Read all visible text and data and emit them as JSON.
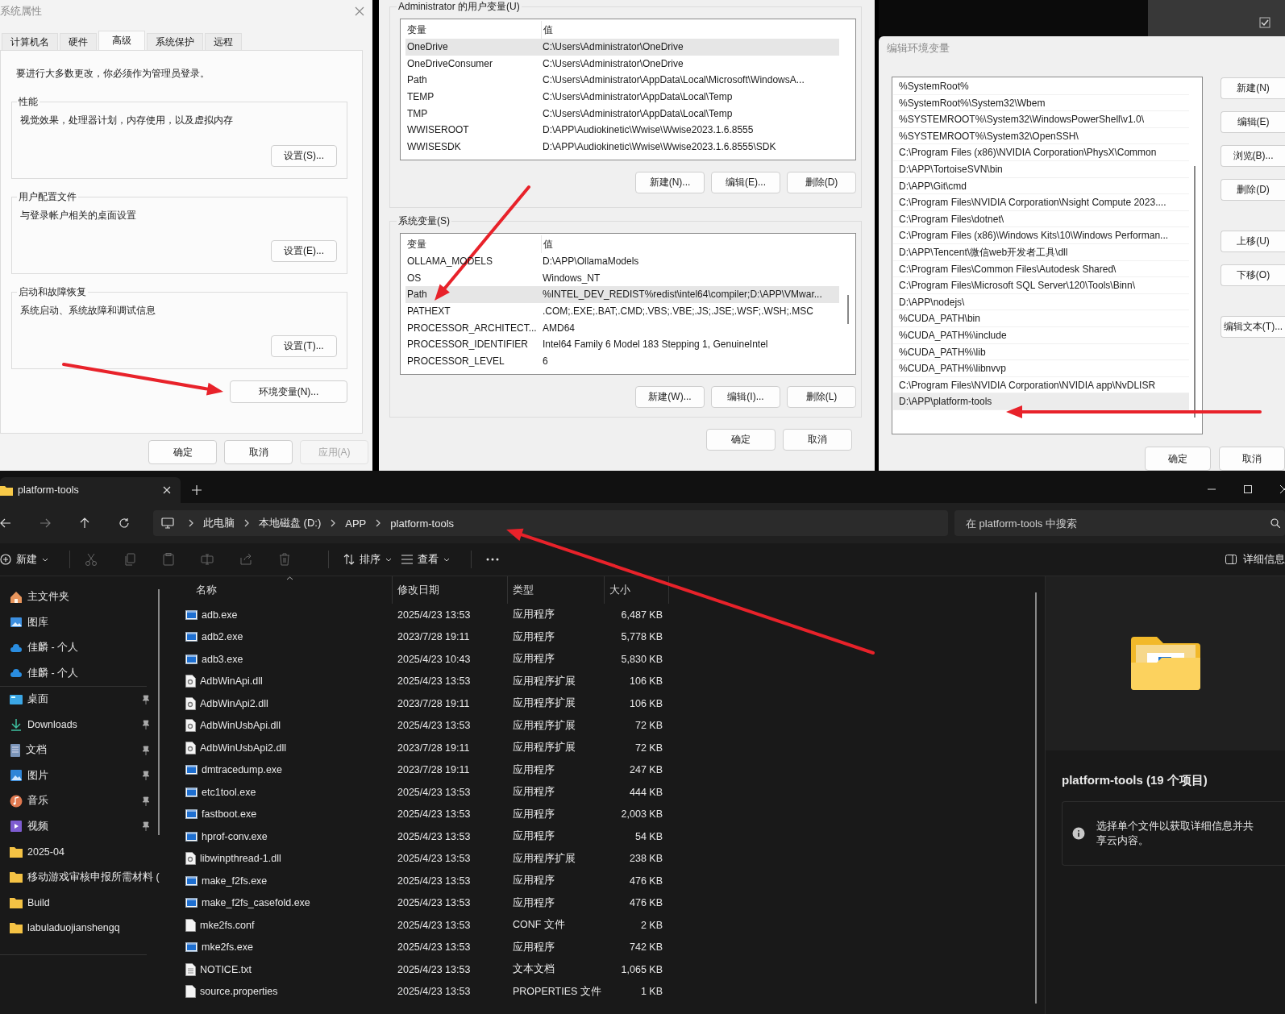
{
  "system_properties": {
    "title": "系统属性",
    "tabs": [
      {
        "label": "计算机名",
        "selected": false
      },
      {
        "label": "硬件",
        "selected": false
      },
      {
        "label": "高级",
        "selected": true
      },
      {
        "label": "系统保护",
        "selected": false
      },
      {
        "label": "远程",
        "selected": false
      }
    ],
    "notice": "要进行大多数更改，你必须作为管理员登录。",
    "groups": [
      {
        "title": "性能",
        "description": "视觉效果，处理器计划，内存使用，以及虚拟内存",
        "button": "设置(S)..."
      },
      {
        "title": "用户配置文件",
        "description": "与登录帐户相关的桌面设置",
        "button": "设置(E)..."
      },
      {
        "title": "启动和故障恢复",
        "description": "系统启动、系统故障和调试信息",
        "button": "设置(T)..."
      }
    ],
    "env_button": "环境变量(N)...",
    "buttons": [
      {
        "label": "确定",
        "disabled": false
      },
      {
        "label": "取消",
        "disabled": false
      },
      {
        "label": "应用(A)",
        "disabled": true
      }
    ]
  },
  "environment_variables": {
    "groups": [
      {
        "title": "Administrator 的用户变量(U)",
        "columns": [
          "变量",
          "值"
        ],
        "rows": [
          {
            "name": "OneDrive",
            "value": "C:\\Users\\Administrator\\OneDrive",
            "selected": true
          },
          {
            "name": "OneDriveConsumer",
            "value": "C:\\Users\\Administrator\\OneDrive",
            "selected": false
          },
          {
            "name": "Path",
            "value": "C:\\Users\\Administrator\\AppData\\Local\\Microsoft\\WindowsA...",
            "selected": false
          },
          {
            "name": "TEMP",
            "value": "C:\\Users\\Administrator\\AppData\\Local\\Temp",
            "selected": false
          },
          {
            "name": "TMP",
            "value": "C:\\Users\\Administrator\\AppData\\Local\\Temp",
            "selected": false
          },
          {
            "name": "WWISEROOT",
            "value": "D:\\APP\\Audiokinetic\\Wwise\\Wwise2023.1.6.8555",
            "selected": false
          },
          {
            "name": "WWISESDK",
            "value": "D:\\APP\\Audiokinetic\\Wwise\\Wwise2023.1.6.8555\\SDK",
            "selected": false
          }
        ],
        "buttons": [
          "新建(N)...",
          "编辑(E)...",
          "删除(D)"
        ]
      },
      {
        "title": "系统变量(S)",
        "columns": [
          "变量",
          "值"
        ],
        "rows": [
          {
            "name": "OLLAMA_MODELS",
            "value": "D:\\APP\\OllamaModels",
            "selected": false
          },
          {
            "name": "OS",
            "value": "Windows_NT",
            "selected": false
          },
          {
            "name": "Path",
            "value": "%INTEL_DEV_REDIST%redist\\intel64\\compiler;D:\\APP\\VMwar...",
            "selected": true
          },
          {
            "name": "PATHEXT",
            "value": ".COM;.EXE;.BAT;.CMD;.VBS;.VBE;.JS;.JSE;.WSF;.WSH;.MSC",
            "selected": false
          },
          {
            "name": "PROCESSOR_ARCHITECT...",
            "value": "AMD64",
            "selected": false
          },
          {
            "name": "PROCESSOR_IDENTIFIER",
            "value": "Intel64 Family 6 Model 183 Stepping 1, GenuineIntel",
            "selected": false
          },
          {
            "name": "PROCESSOR_LEVEL",
            "value": "6",
            "selected": false
          }
        ],
        "buttons": [
          "新建(W)...",
          "编辑(I)...",
          "删除(L)"
        ]
      }
    ],
    "buttons": [
      "确定",
      "取消"
    ]
  },
  "edit_environment_variable": {
    "title": "编辑环境变量",
    "entries": [
      {
        "text": "%SystemRoot%",
        "selected": false
      },
      {
        "text": "%SystemRoot%\\System32\\Wbem",
        "selected": false
      },
      {
        "text": "%SYSTEMROOT%\\System32\\WindowsPowerShell\\v1.0\\",
        "selected": false
      },
      {
        "text": "%SYSTEMROOT%\\System32\\OpenSSH\\",
        "selected": false
      },
      {
        "text": "C:\\Program Files (x86)\\NVIDIA Corporation\\PhysX\\Common",
        "selected": false
      },
      {
        "text": "D:\\APP\\TortoiseSVN\\bin",
        "selected": false
      },
      {
        "text": "D:\\APP\\Git\\cmd",
        "selected": false
      },
      {
        "text": "C:\\Program Files\\NVIDIA Corporation\\Nsight Compute 2023....",
        "selected": false
      },
      {
        "text": "C:\\Program Files\\dotnet\\",
        "selected": false
      },
      {
        "text": "C:\\Program Files (x86)\\Windows Kits\\10\\Windows Performan...",
        "selected": false
      },
      {
        "text": "D:\\APP\\Tencent\\微信web开发者工具\\dll",
        "selected": false
      },
      {
        "text": "C:\\Program Files\\Common Files\\Autodesk Shared\\",
        "selected": false
      },
      {
        "text": "C:\\Program Files\\Microsoft SQL Server\\120\\Tools\\Binn\\",
        "selected": false
      },
      {
        "text": "D:\\APP\\nodejs\\",
        "selected": false
      },
      {
        "text": "%CUDA_PATH\\bin",
        "selected": false
      },
      {
        "text": "%CUDA_PATH%\\include",
        "selected": false
      },
      {
        "text": "%CUDA_PATH%\\lib",
        "selected": false
      },
      {
        "text": "%CUDA_PATH%\\libnvvp",
        "selected": false
      },
      {
        "text": "C:\\Program Files\\NVIDIA Corporation\\NVIDIA app\\NvDLISR",
        "selected": false
      },
      {
        "text": "D:\\APP\\platform-tools",
        "selected": true
      }
    ],
    "side_button_groups": [
      [
        "新建(N)",
        "编辑(E)",
        "浏览(B)...",
        "删除(D)"
      ],
      [
        "上移(U)",
        "下移(O)"
      ],
      [
        "编辑文本(T)..."
      ]
    ],
    "buttons": [
      "确定",
      "取消"
    ]
  },
  "explorer": {
    "tab": {
      "title": "platform-tools"
    },
    "breadcrumbs": [
      "此电脑",
      "本地磁盘 (D:)",
      "APP",
      "platform-tools"
    ],
    "search": {
      "placeholder": "在 platform-tools 中搜索"
    },
    "toolbar": {
      "new": "新建",
      "sort": "排序",
      "view": "查看",
      "details": "详细信息"
    },
    "sidebar": {
      "sections": [
        [
          {
            "label": "主文件夹",
            "kind": "home",
            "pinned": false
          },
          {
            "label": "图库",
            "kind": "gallery",
            "pinned": false
          },
          {
            "label": "佳麟 - 个人",
            "kind": "cloud",
            "pinned": false
          },
          {
            "label": "佳麟 - 个人",
            "kind": "cloud",
            "pinned": false
          }
        ],
        [
          {
            "label": "桌面",
            "kind": "desktop",
            "pinned": true
          },
          {
            "label": "Downloads",
            "kind": "download",
            "pinned": true
          },
          {
            "label": "文档",
            "kind": "document",
            "pinned": true
          },
          {
            "label": "图片",
            "kind": "pictures",
            "pinned": true
          },
          {
            "label": "音乐",
            "kind": "music",
            "pinned": true
          },
          {
            "label": "视频",
            "kind": "video",
            "pinned": true
          },
          {
            "label": "2025-04",
            "kind": "folder",
            "pinned": false
          },
          {
            "label": "移动游戏审核申报所需材料 (",
            "kind": "folder",
            "pinned": false
          },
          {
            "label": "Build",
            "kind": "folder",
            "pinned": false
          },
          {
            "label": "labuladuojianshengq",
            "kind": "folder",
            "pinned": false
          }
        ]
      ]
    },
    "columns": [
      "名称",
      "修改日期",
      "类型",
      "大小"
    ],
    "files": [
      {
        "name": "adb.exe",
        "kind": "exe",
        "date": "2025/4/23 13:53",
        "type": "应用程序",
        "size": "6,487 KB"
      },
      {
        "name": "adb2.exe",
        "kind": "exe",
        "date": "2023/7/28 19:11",
        "type": "应用程序",
        "size": "5,778 KB"
      },
      {
        "name": "adb3.exe",
        "kind": "exe",
        "date": "2025/4/23 10:43",
        "type": "应用程序",
        "size": "5,830 KB"
      },
      {
        "name": "AdbWinApi.dll",
        "kind": "dll",
        "date": "2025/4/23 13:53",
        "type": "应用程序扩展",
        "size": "106 KB"
      },
      {
        "name": "AdbWinApi2.dll",
        "kind": "dll",
        "date": "2023/7/28 19:11",
        "type": "应用程序扩展",
        "size": "106 KB"
      },
      {
        "name": "AdbWinUsbApi.dll",
        "kind": "dll",
        "date": "2025/4/23 13:53",
        "type": "应用程序扩展",
        "size": "72 KB"
      },
      {
        "name": "AdbWinUsbApi2.dll",
        "kind": "dll",
        "date": "2023/7/28 19:11",
        "type": "应用程序扩展",
        "size": "72 KB"
      },
      {
        "name": "dmtracedump.exe",
        "kind": "exe",
        "date": "2023/7/28 19:11",
        "type": "应用程序",
        "size": "247 KB"
      },
      {
        "name": "etc1tool.exe",
        "kind": "exe",
        "date": "2025/4/23 13:53",
        "type": "应用程序",
        "size": "444 KB"
      },
      {
        "name": "fastboot.exe",
        "kind": "exe",
        "date": "2025/4/23 13:53",
        "type": "应用程序",
        "size": "2,003 KB"
      },
      {
        "name": "hprof-conv.exe",
        "kind": "exe",
        "date": "2025/4/23 13:53",
        "type": "应用程序",
        "size": "54 KB"
      },
      {
        "name": "libwinpthread-1.dll",
        "kind": "dll",
        "date": "2025/4/23 13:53",
        "type": "应用程序扩展",
        "size": "238 KB"
      },
      {
        "name": "make_f2fs.exe",
        "kind": "exe",
        "date": "2025/4/23 13:53",
        "type": "应用程序",
        "size": "476 KB"
      },
      {
        "name": "make_f2fs_casefold.exe",
        "kind": "exe",
        "date": "2025/4/23 13:53",
        "type": "应用程序",
        "size": "476 KB"
      },
      {
        "name": "mke2fs.conf",
        "kind": "file",
        "date": "2025/4/23 13:53",
        "type": "CONF 文件",
        "size": "2 KB"
      },
      {
        "name": "mke2fs.exe",
        "kind": "exe",
        "date": "2025/4/23 13:53",
        "type": "应用程序",
        "size": "742 KB"
      },
      {
        "name": "NOTICE.txt",
        "kind": "text",
        "date": "2025/4/23 13:53",
        "type": "文本文档",
        "size": "1,065 KB"
      },
      {
        "name": "source.properties",
        "kind": "file",
        "date": "2025/4/23 13:53",
        "type": "PROPERTIES 文件",
        "size": "1 KB"
      }
    ],
    "details": {
      "title": "platform-tools (19 个项目)",
      "info": "选择单个文件以获取详细信息并共享云内容。"
    }
  }
}
